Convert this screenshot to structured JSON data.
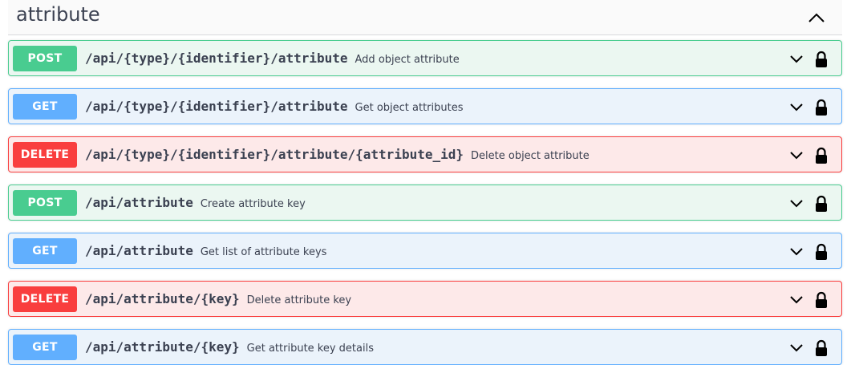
{
  "section": {
    "title": "attribute"
  },
  "operations": [
    {
      "method": "POST",
      "path": "/api/{type}/{identifier}/attribute",
      "summary": "Add object attribute"
    },
    {
      "method": "GET",
      "path": "/api/{type}/{identifier}/attribute",
      "summary": "Get object attributes"
    },
    {
      "method": "DELETE",
      "path": "/api/{type}/{identifier}/attribute/{attribute_id}",
      "summary": "Delete object attribute"
    },
    {
      "method": "POST",
      "path": "/api/attribute",
      "summary": "Create attribute key"
    },
    {
      "method": "GET",
      "path": "/api/attribute",
      "summary": "Get list of attribute keys"
    },
    {
      "method": "DELETE",
      "path": "/api/attribute/{key}",
      "summary": "Delete attribute key"
    },
    {
      "method": "GET",
      "path": "/api/attribute/{key}",
      "summary": "Get attribute key details"
    }
  ],
  "colors": {
    "post": "#49cc90",
    "get": "#61affe",
    "delete": "#f93e3e"
  },
  "icons": {
    "expand": "chevron-down-icon",
    "collapse": "chevron-up-icon",
    "auth": "lock-icon"
  }
}
